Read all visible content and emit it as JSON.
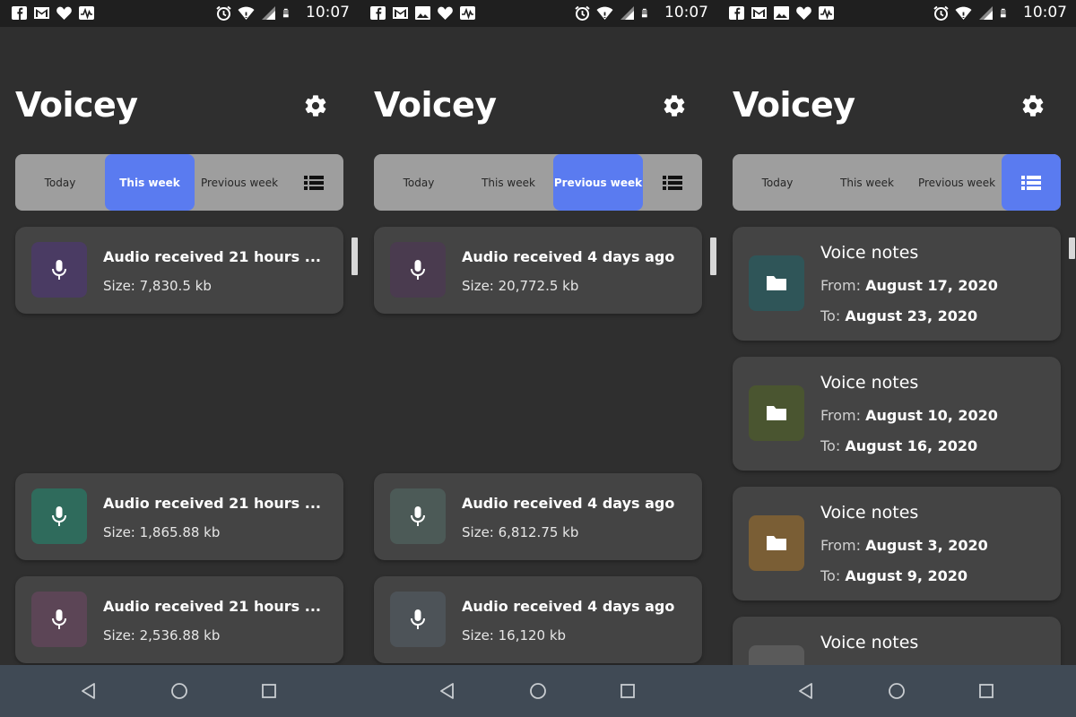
{
  "status_bar": {
    "time": "10:07"
  },
  "app": {
    "title": "Voicey"
  },
  "tabs": {
    "today": "Today",
    "this_week": "This week",
    "previous_week": "Previous week"
  },
  "screens": [
    {
      "active_tab": "this_week",
      "recordings": [
        {
          "title": "Audio received 21 hours ...",
          "size": "Size: 7,830.5 kb",
          "color": "#4a3b63"
        },
        {
          "title": "Audio received 21 hours ...",
          "size": "Size: 1,865.88 kb",
          "color": "#2f6b5c"
        },
        {
          "title": "Audio received 21 hours ...",
          "size": "Size: 2,536.88 kb",
          "color": "#5c4556"
        }
      ]
    },
    {
      "active_tab": "previous_week",
      "recordings": [
        {
          "title": "Audio received 4 days ago",
          "size": "Size: 20,772.5 kb",
          "color": "#4a3b4f"
        },
        {
          "title": "Audio received 4 days ago",
          "size": "Size: 6,812.75 kb",
          "color": "#4c5a57"
        },
        {
          "title": "Audio received 4 days ago",
          "size": "Size: 16,120 kb",
          "color": "#4d5358"
        }
      ]
    },
    {
      "active_tab": "list",
      "folders": [
        {
          "title": "Voice notes",
          "from_label": "From:",
          "from": "August 17, 2020",
          "to_label": "To:",
          "to": "August 23, 2020",
          "color": "#2f5558"
        },
        {
          "title": "Voice notes",
          "from_label": "From:",
          "from": "August 10, 2020",
          "to_label": "To:",
          "to": "August 16, 2020",
          "color": "#4a5530"
        },
        {
          "title": "Voice notes",
          "from_label": "From:",
          "from": "August 3, 2020",
          "to_label": "To:",
          "to": "August 9, 2020",
          "color": "#7a5e35"
        },
        {
          "title": "Voice notes",
          "color": "#5a5a5a"
        }
      ]
    }
  ],
  "colors": {
    "accent": "#5a7bf0",
    "tabbar": "#9e9e9e",
    "card": "#444444",
    "background": "#2f2f2f"
  },
  "icons": [
    "facebook-icon",
    "gmail-icon",
    "image-icon",
    "heart-icon",
    "pulse-icon",
    "alarm-icon",
    "wifi-icon",
    "signal-icon",
    "battery-icon",
    "gear-icon",
    "list-view-icon",
    "microphone-icon",
    "folder-icon",
    "back-icon",
    "home-icon",
    "recents-icon"
  ]
}
